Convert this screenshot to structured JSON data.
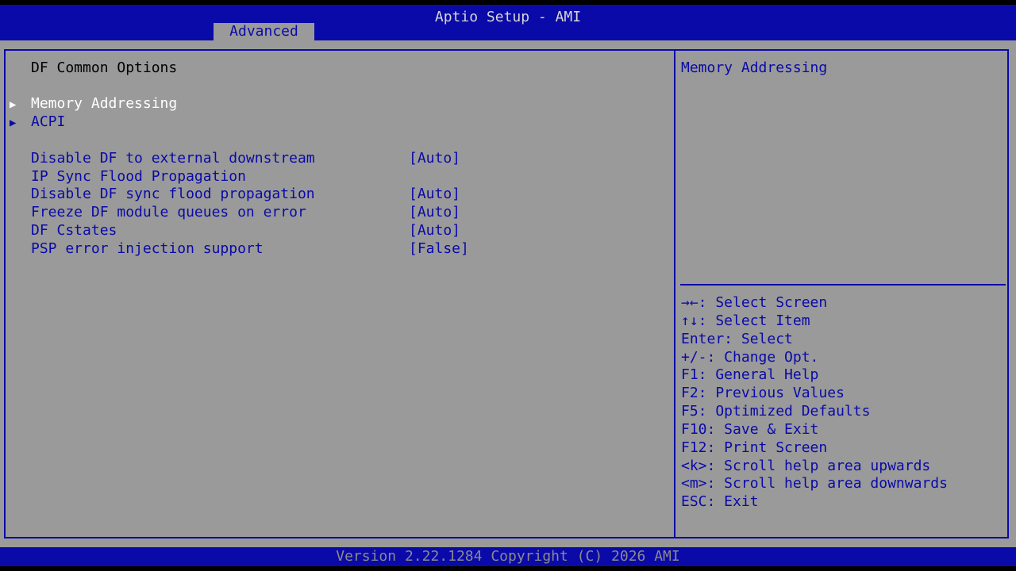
{
  "header": {
    "title": "Aptio Setup - AMI",
    "active_tab": "Advanced"
  },
  "main": {
    "section_title": "DF Common Options",
    "submenus": [
      {
        "label": "Memory Addressing",
        "selected": true
      },
      {
        "label": "ACPI",
        "selected": false
      }
    ],
    "settings": [
      {
        "label": "Disable DF to external downstream",
        "label2": "IP Sync Flood Propagation",
        "value": "[Auto]"
      },
      {
        "label": "Disable DF sync flood propagation",
        "value": "[Auto]"
      },
      {
        "label": "Freeze DF module queues on error",
        "value": "[Auto]"
      },
      {
        "label": "DF Cstates",
        "value": "[Auto]"
      },
      {
        "label": "PSP error injection support",
        "value": "[False]"
      }
    ]
  },
  "help": {
    "description": "Memory Addressing",
    "keys": [
      "→←: Select Screen",
      "↑↓: Select Item",
      "Enter: Select",
      "+/-: Change Opt.",
      "F1: General Help",
      "F2: Previous Values",
      "F5: Optimized Defaults",
      "F10: Save & Exit",
      "F12: Print Screen",
      "<k>: Scroll help area upwards",
      "<m>: Scroll help area downwards",
      "ESC: Exit"
    ]
  },
  "footer": {
    "version": "Version 2.22.1284 Copyright (C) 2026 AMI"
  },
  "colors": {
    "bios_blue": "#0a0aa8",
    "panel_gray": "#9a9a9a",
    "selected_white": "#ffffff"
  },
  "icons": {
    "submenu_arrow": "right-triangle-icon"
  }
}
